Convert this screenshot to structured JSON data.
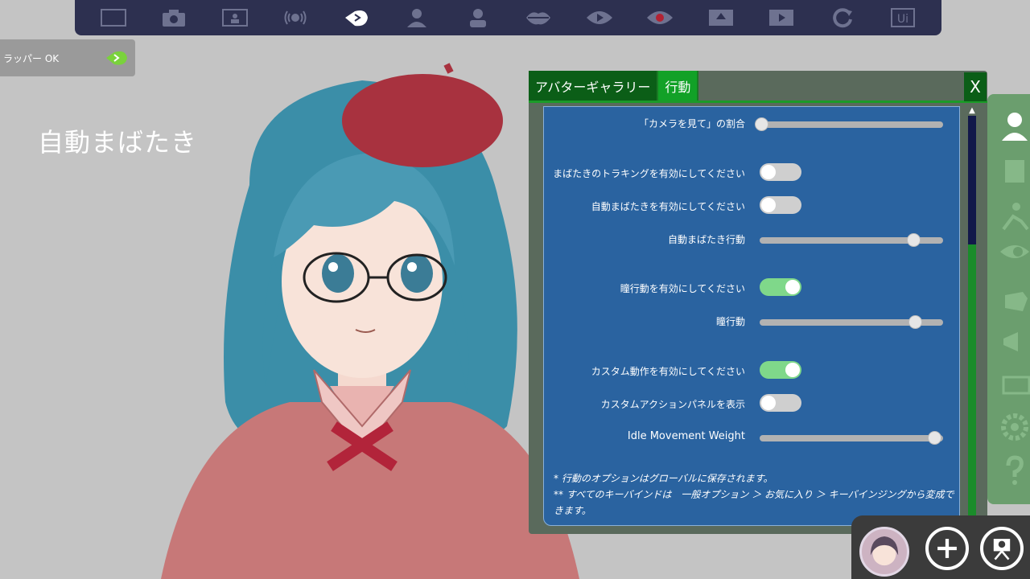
{
  "toolbar": {
    "icons": [
      "frame-icon",
      "camera-icon",
      "screen-icon",
      "broadcast-icon",
      "blink-face-icon",
      "avatar-icon",
      "person-gear-icon",
      "lips-icon",
      "eye-play-icon",
      "eye-record-icon",
      "film-upload-icon",
      "film-play-icon",
      "reload-icon",
      "ui-icon"
    ],
    "ui_label": "Ui"
  },
  "status": {
    "text": "ラッパー OK"
  },
  "overlay": {
    "title": "自動まばたき"
  },
  "panel": {
    "tabs": [
      "アバターギャラリー",
      "行動"
    ],
    "close_label": "X",
    "rows": [
      {
        "label": "「カメラを見て」の割合",
        "type": "slider",
        "value": 0.0
      },
      {
        "label": "まばたきのトラキングを有効にしてください",
        "type": "toggle",
        "on": false
      },
      {
        "label": "自動まばたきを有効にしてください",
        "type": "toggle",
        "on": false
      },
      {
        "label": "自動まばたき行動",
        "type": "slider",
        "value": 0.85
      },
      {
        "label": "瞳行動を有効にしてください",
        "type": "toggle",
        "on": true
      },
      {
        "label": "瞳行動",
        "type": "slider",
        "value": 0.86
      },
      {
        "label": "カスタム動作を有効にしてください",
        "type": "toggle",
        "on": true
      },
      {
        "label": "カスタムアクションパネルを表示",
        "type": "toggle",
        "on": false
      },
      {
        "label": "Idle Movement Weight",
        "type": "slider",
        "value": 0.95
      }
    ],
    "notes": [
      "* 行動のオプションはグローバルに保存されます。",
      "** すべてのキーバインドは　一般オプション ＞ お気に入り ＞ キーバインジングから変成できます。"
    ]
  },
  "colors": {
    "panel_bg": "#2a63a0",
    "tab_active": "#12a127",
    "tab_inactive": "#0b5e17",
    "toggle_on": "#7fd88a",
    "sidebar": "#6b9e6e"
  }
}
